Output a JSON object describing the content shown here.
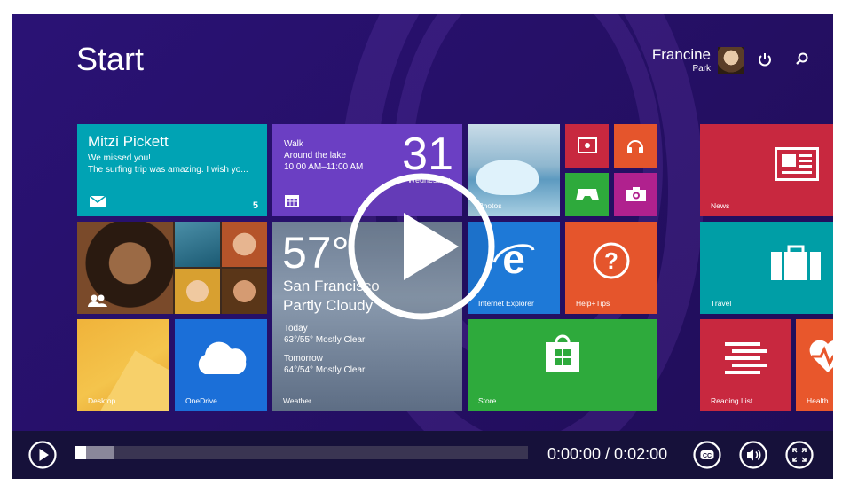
{
  "start": {
    "title": "Start"
  },
  "user": {
    "first_name": "Francine",
    "last_name": "Park"
  },
  "icons": {
    "power": "power-icon",
    "search": "search-icon"
  },
  "tiles": {
    "mail": {
      "name": "Mitzi Pickett",
      "line1": "We missed you!",
      "line2": "The surfing trip was amazing. I wish yo...",
      "count": "5",
      "color": "#00a3b4"
    },
    "calendar": {
      "line1": "Walk",
      "line2": "Around the lake",
      "line3": "10:00 AM–11:00 AM",
      "day": "31",
      "weekday": "Wednesday",
      "color": "#6b3fc3"
    },
    "photos": {
      "label": "Photos"
    },
    "people": {
      "color": "#d0383f"
    },
    "weather": {
      "temp": "57°",
      "city": "San Francisco",
      "condition": "Partly Cloudy",
      "today_label": "Today",
      "today": "63°/55° Mostly Clear",
      "tomorrow_label": "Tomorrow",
      "tomorrow": "64°/54° Mostly Clear",
      "label": "Weather"
    },
    "desktop": {
      "label": "Desktop"
    },
    "onedrive": {
      "label": "OneDrive",
      "color": "#1b6fd8"
    },
    "ie": {
      "label": "Internet Explorer",
      "color": "#1e79d7"
    },
    "help": {
      "label": "Help+Tips",
      "color": "#e5552c"
    },
    "store": {
      "label": "Store",
      "color": "#2eaa3c"
    },
    "news": {
      "label": "News",
      "color": "#c8283f"
    },
    "travel": {
      "label": "Travel",
      "color": "#009ea6"
    },
    "reading": {
      "label": "Reading List",
      "color": "#c8283f"
    },
    "health": {
      "label": "Health",
      "color": "#e8572c"
    },
    "video": {
      "color": "#c8283f"
    },
    "music": {
      "color": "#e5552c"
    },
    "games": {
      "color": "#2eaa3c"
    },
    "camera": {
      "color": "#b0218e"
    }
  },
  "player": {
    "time": "0:00:00 / 0:02:00",
    "progress": 0.0,
    "buffered": 0.06,
    "cc_label": "CC"
  }
}
